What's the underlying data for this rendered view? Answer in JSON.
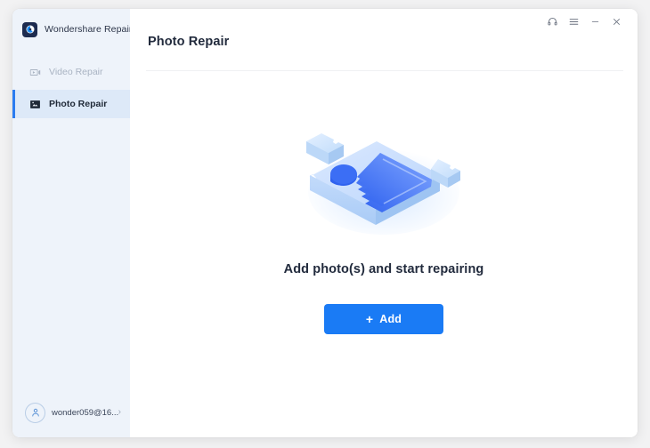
{
  "app": {
    "brand_name": "Wondershare Repairit",
    "logo_icon": "repairit-logo-icon"
  },
  "sidebar": {
    "items": [
      {
        "label": "Video Repair",
        "icon": "video-icon",
        "state": "disabled"
      },
      {
        "label": "Photo Repair",
        "icon": "photo-icon",
        "state": "active"
      }
    ],
    "account": {
      "name": "wonder059@16...",
      "avatar_icon": "user-avatar-icon",
      "chevron": "›"
    }
  },
  "titlebar": {
    "buttons": [
      {
        "name": "support-icon",
        "glyph": "headset"
      },
      {
        "name": "menu-icon",
        "glyph": "hamburger"
      },
      {
        "name": "minimize-icon",
        "glyph": "minimize"
      },
      {
        "name": "close-icon",
        "glyph": "close"
      }
    ]
  },
  "main": {
    "page_title": "Photo Repair",
    "empty_state": {
      "illustration": "photo-puzzle-illustration",
      "message": "Add photo(s) and start repairing",
      "button_label": "Add",
      "button_plus": "+"
    }
  },
  "colors": {
    "accent_blue": "#1a7bf5",
    "sidebar_bg": "#eef3fa",
    "active_item_bg": "#dde9f8",
    "active_bar": "#2b7cf0",
    "title_text": "#222b3d",
    "disabled_text": "#a9b3c2",
    "page_bg": "#f2f2f3"
  }
}
